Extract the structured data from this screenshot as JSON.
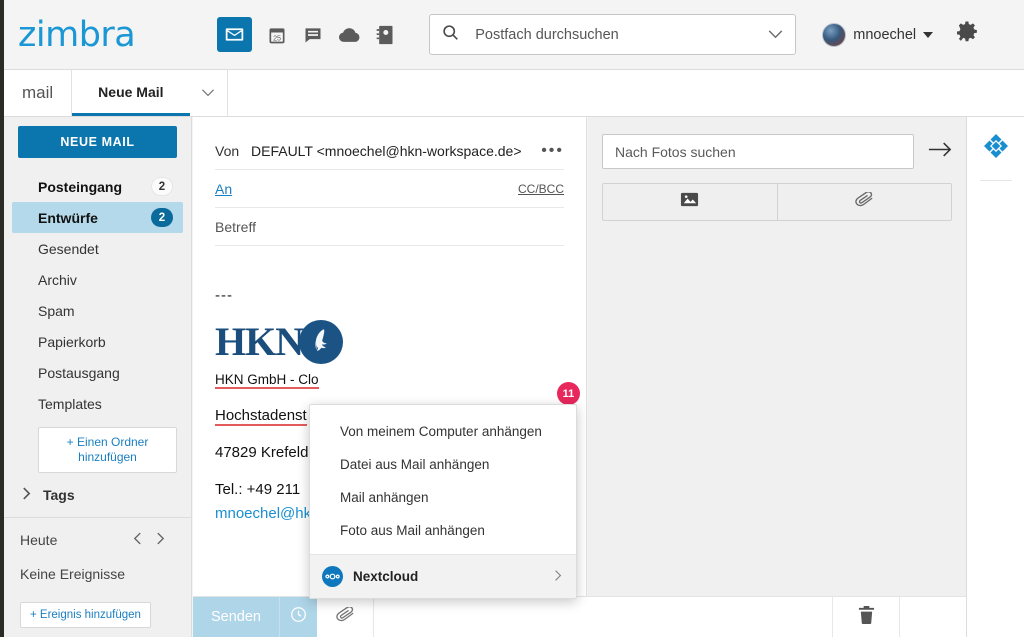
{
  "header": {
    "logo_text": "zimbra",
    "app_icons": [
      {
        "name": "mail-icon",
        "label": "Mail",
        "active": true
      },
      {
        "name": "calendar-icon",
        "label": "Kalender",
        "day": "25",
        "active": false
      },
      {
        "name": "chat-icon",
        "label": "Chat",
        "active": false
      },
      {
        "name": "cloud-icon",
        "label": "Drive",
        "active": false
      },
      {
        "name": "contacts-icon",
        "label": "Kontakte",
        "active": false
      }
    ],
    "search": {
      "placeholder": "Postfach durchsuchen",
      "value": ""
    },
    "user": {
      "name": "mnoechel"
    },
    "settings_label": "Einstellungen"
  },
  "tabbar": {
    "app_label": "mail",
    "active_tab": "Neue Mail"
  },
  "sidebar": {
    "compose_button": "NEUE MAIL",
    "folders": [
      {
        "label": "Posteingang",
        "count": "2",
        "style": "light",
        "selected": false
      },
      {
        "label": "Entwürfe",
        "count": "2",
        "style": "dark",
        "selected": true
      },
      {
        "label": "Gesendet",
        "count": "",
        "style": "",
        "selected": false
      },
      {
        "label": "Archiv",
        "count": "",
        "style": "",
        "selected": false
      },
      {
        "label": "Spam",
        "count": "",
        "style": "",
        "selected": false
      },
      {
        "label": "Papierkorb",
        "count": "",
        "style": "",
        "selected": false
      },
      {
        "label": "Postausgang",
        "count": "",
        "style": "",
        "selected": false
      },
      {
        "label": "Templates",
        "count": "",
        "style": "",
        "selected": false
      }
    ],
    "add_folder": "+ Einen Ordner hinzufügen",
    "tags_label": "Tags",
    "calendar": {
      "title": "Heute",
      "empty_text": "Keine Ereignisse",
      "add_event": "+ Ereignis hinzufügen"
    }
  },
  "compose": {
    "from_label": "Von",
    "from_value": "DEFAULT <mnoechel@hkn-workspace.de>",
    "to_label": "An",
    "to_value": "",
    "ccbcc_label": "CC/BCC",
    "subject_placeholder": "Betreff",
    "subject_value": "",
    "signature": {
      "separator": "---",
      "logo_text": "HKN",
      "company": "HKN GmbH - Clo",
      "street": "Hochstadenst",
      "city": "47829 Krefeld",
      "phone": "Tel.: +49 211 ",
      "email": "mnoechel@hk"
    },
    "attachment_badge": "11"
  },
  "attach_menu": {
    "items": [
      {
        "label": "Von meinem Computer anhängen"
      },
      {
        "label": "Datei aus Mail anhängen"
      },
      {
        "label": "Mail anhängen"
      },
      {
        "label": "Foto aus Mail anhängen"
      }
    ],
    "nextcloud": {
      "label": "Nextcloud"
    }
  },
  "photo_panel": {
    "search_placeholder": "Nach Fotos suchen",
    "search_value": "",
    "toggles": [
      {
        "name": "photo-tab",
        "icon": "image-icon"
      },
      {
        "name": "attachment-tab",
        "icon": "paperclip-icon"
      }
    ]
  },
  "bottom_bar": {
    "send_label": "Senden",
    "schedule_icon": "clock-icon",
    "attach_icon": "paperclip-icon",
    "delete_icon": "trash-icon"
  },
  "colors": {
    "brand_blue": "#0b76ae",
    "logo_blue": "#1a97d4",
    "selected_row": "#b3d9ea",
    "badge_red": "#e8285c",
    "link_blue": "#1a7fc1"
  }
}
